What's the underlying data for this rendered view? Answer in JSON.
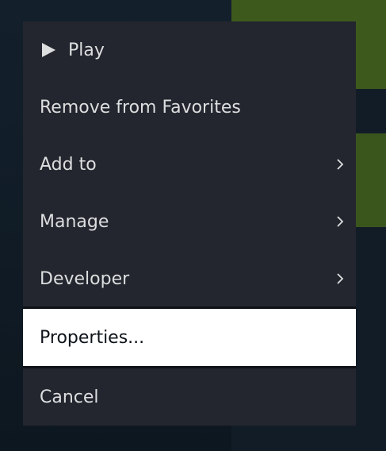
{
  "context_menu": {
    "items": [
      {
        "label": "Play",
        "icon": "play-icon"
      },
      {
        "label": "Remove from Favorites"
      },
      {
        "label": "Add to",
        "icon": "chevron-right-icon"
      },
      {
        "label": "Manage",
        "icon": "chevron-right-icon"
      },
      {
        "label": "Developer",
        "icon": "chevron-right-icon"
      },
      {
        "label": "Properties...",
        "state": "selected"
      },
      {
        "label": "Cancel"
      }
    ]
  },
  "colors": {
    "menu_background": "#23262e",
    "menu_text": "#dcdedf",
    "selected_background": "#ffffff",
    "selected_text": "#0e141b",
    "backdrop": "#0f1822",
    "backdrop_accent": "#3d5a1c"
  }
}
